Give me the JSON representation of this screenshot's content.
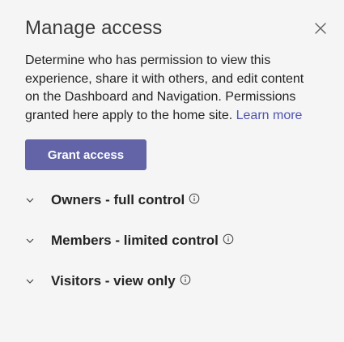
{
  "dialog": {
    "title": "Manage access",
    "close_icon": "close-icon",
    "description": "Determine who has permission to view this experience, share it with others, and edit content on the Dashboard and Navigation. Permissions granted here apply to the home site.",
    "learn_more_label": "Learn more",
    "grant_button_label": "Grant access",
    "accent_color": "#6264a7"
  },
  "groups": [
    {
      "label": "Owners - full control",
      "icon": "chevron-down-icon",
      "info_icon": "info-icon"
    },
    {
      "label": "Members - limited control",
      "icon": "chevron-down-icon",
      "info_icon": "info-icon"
    },
    {
      "label": "Visitors - view only",
      "icon": "chevron-down-icon",
      "info_icon": "info-icon"
    }
  ]
}
